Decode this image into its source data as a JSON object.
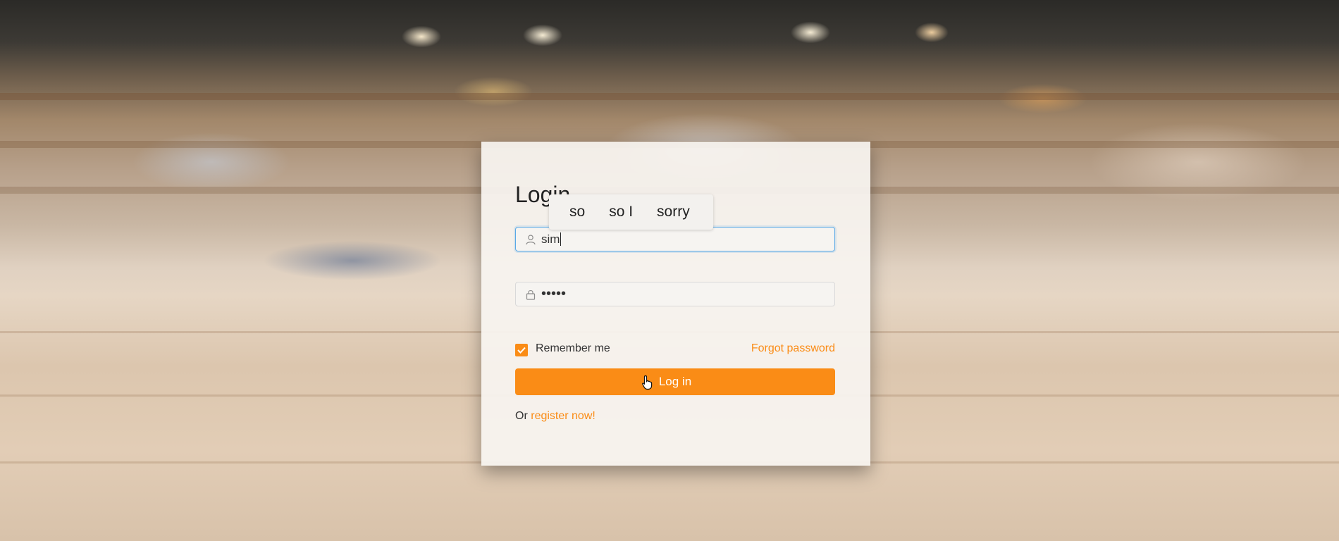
{
  "login": {
    "title": "Login",
    "username_value": "sim",
    "password_masked": "•••••",
    "remember_label": "Remember me",
    "remember_checked": true,
    "forgot_label": "Forgot password",
    "login_button_label": "Log in",
    "register_prefix": "Or",
    "register_link": "register now!"
  },
  "autocomplete": {
    "suggestions": [
      "so",
      "so I",
      "sorry"
    ]
  },
  "colors": {
    "accent": "#fa8c16",
    "focus_border": "#5aa9e6",
    "card_background": "#f7f4f0"
  },
  "icons": {
    "username": "user-icon",
    "password": "lock-icon",
    "checkbox": "checkmark-icon",
    "pointer": "hand-pointer-icon"
  }
}
